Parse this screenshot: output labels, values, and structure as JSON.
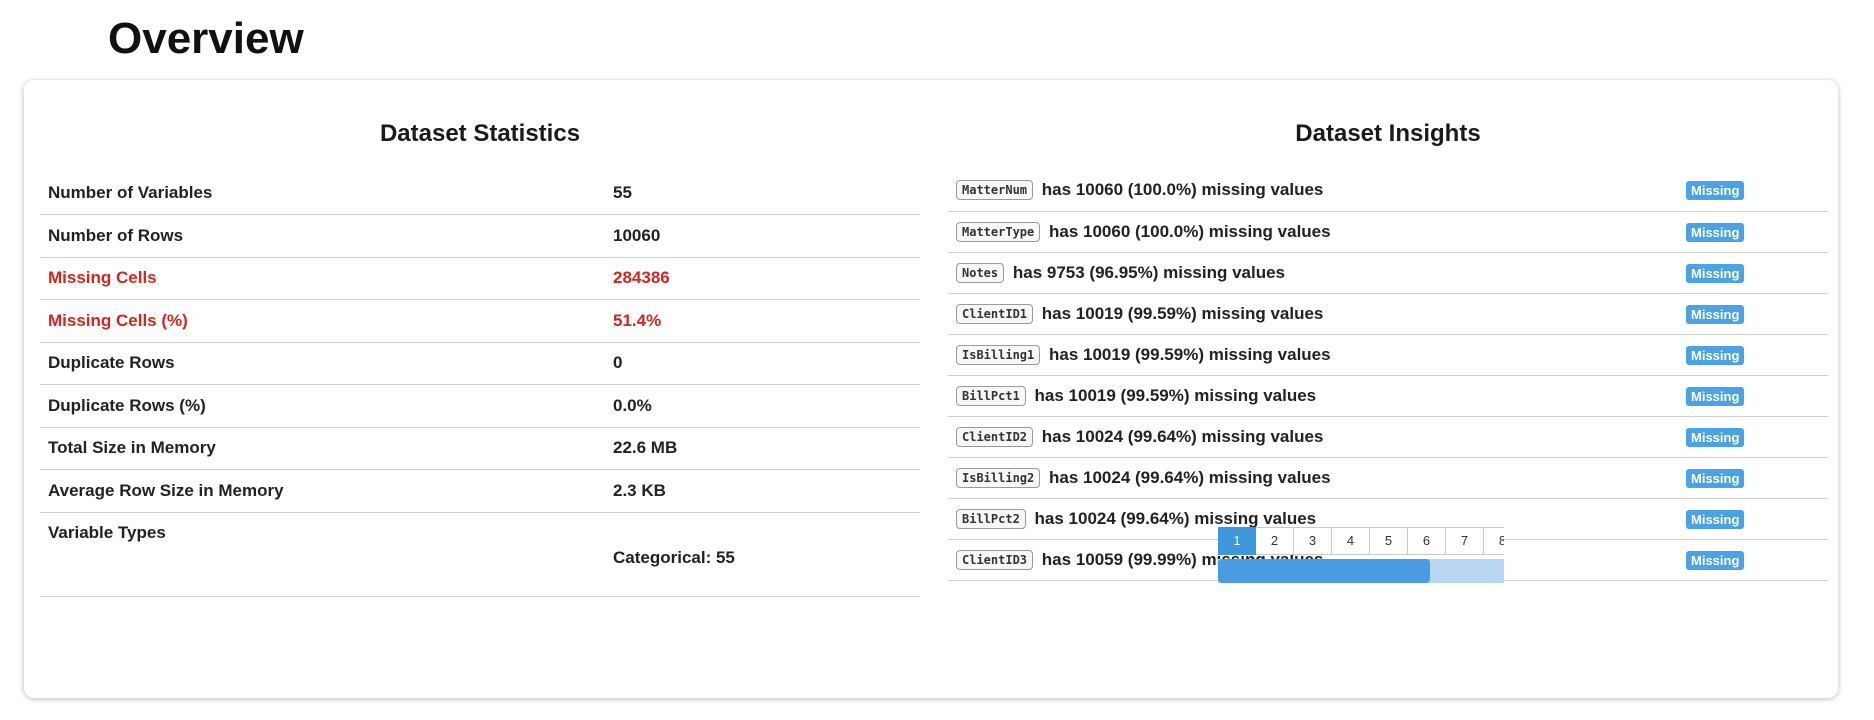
{
  "page": {
    "title": "Overview"
  },
  "stats": {
    "title": "Dataset Statistics",
    "rows": [
      {
        "label": "Number of Variables",
        "value": "55"
      },
      {
        "label": "Number of Rows",
        "value": "10060"
      },
      {
        "label": "Missing Cells",
        "value": "284386"
      },
      {
        "label": "Missing Cells (%)",
        "value": "51.4%"
      },
      {
        "label": "Duplicate Rows",
        "value": "0"
      },
      {
        "label": "Duplicate Rows (%)",
        "value": "0.0%"
      },
      {
        "label": "Total Size in Memory",
        "value": "22.6 MB"
      },
      {
        "label": "Average Row Size in Memory",
        "value": "2.3 KB"
      },
      {
        "label": "Variable Types",
        "value": "Categorical: 55"
      }
    ],
    "alert_color": "#d6261c"
  },
  "insights": {
    "title": "Dataset Insights",
    "badge_color": "#4aa3e6",
    "rows": [
      {
        "column": "MatterNum",
        "text": "has 10060 (100.0%) missing values",
        "badge": "Missing"
      },
      {
        "column": "MatterType",
        "text": "has 10060 (100.0%) missing values",
        "badge": "Missing"
      },
      {
        "column": "Notes",
        "text": "has 9753 (96.95%) missing values",
        "badge": "Missing"
      },
      {
        "column": "ClientID1",
        "text": "has 10019 (99.59%) missing values",
        "badge": "Missing"
      },
      {
        "column": "IsBilling1",
        "text": "has 10019 (99.59%) missing values",
        "badge": "Missing"
      },
      {
        "column": "BillPct1",
        "text": "has 10019 (99.59%) missing values",
        "badge": "Missing"
      },
      {
        "column": "ClientID2",
        "text": "has 10024 (99.64%) missing values",
        "badge": "Missing"
      },
      {
        "column": "IsBilling2",
        "text": "has 10024 (99.64%) missing values",
        "badge": "Missing"
      },
      {
        "column": "BillPct2",
        "text": "has 10024 (99.64%) missing values",
        "badge": "Missing"
      },
      {
        "column": "ClientID3",
        "text": "has 10059 (99.99%) missing values",
        "badge": "Missing"
      }
    ]
  },
  "pagination": {
    "pages": [
      "1",
      "2",
      "3",
      "4",
      "5",
      "6",
      "7",
      "8"
    ],
    "active": "1",
    "scroll_fraction": 0.74
  }
}
